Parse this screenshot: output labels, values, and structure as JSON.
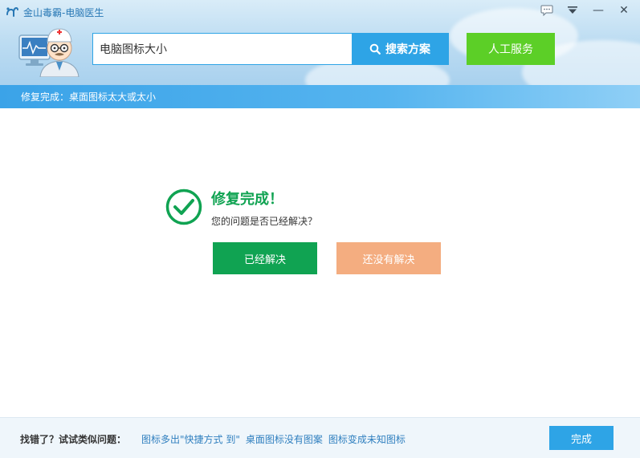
{
  "window": {
    "title": "金山毒霸-电脑医生",
    "controls": {
      "feedback_icon": "chat-bubble-icon",
      "menu_icon": "dropdown-menu-icon",
      "minimize_label": "—",
      "close_label": "✕"
    }
  },
  "header": {
    "search": {
      "value": "电脑图标大小",
      "button_label": "搜索方案"
    },
    "service_button_label": "人工服务"
  },
  "status": {
    "text": "修复完成：桌面图标太大或太小"
  },
  "main": {
    "title": "修复完成！",
    "question": "您的问题是否已经解决？",
    "solved_button": "已经解决",
    "unsolved_button": "还没有解决"
  },
  "footer": {
    "label": "找错了？试试类似问题：",
    "links": [
      "图标多出\"快捷方式 到\"",
      "桌面图标没有图案",
      "图标变成未知图标"
    ],
    "done_button": "完成"
  },
  "colors": {
    "accent_blue": "#2ea4e6",
    "success_green": "#10a352",
    "service_green": "#5ccf27",
    "unsolved_orange": "#f4ad80"
  }
}
